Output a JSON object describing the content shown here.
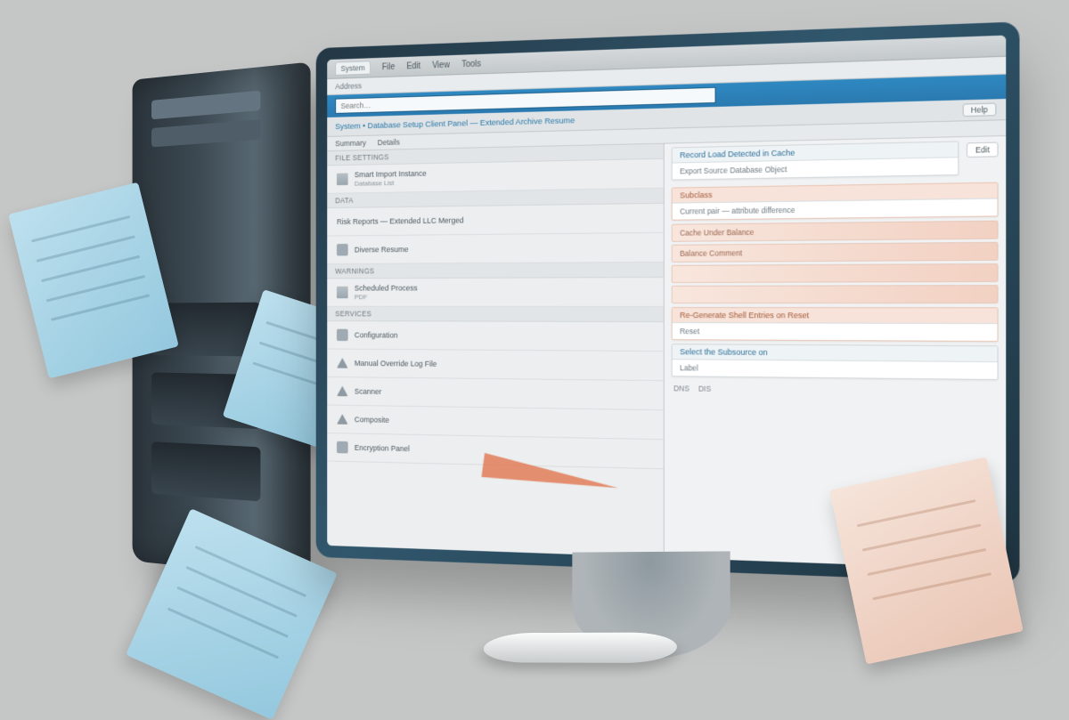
{
  "titlebar": {
    "tab": "System",
    "menus": [
      "File",
      "Edit",
      "View",
      "Tools"
    ]
  },
  "toolbar": {
    "address_label": "Address"
  },
  "search": {
    "placeholder": "Search…"
  },
  "header": {
    "title": "System • Database Setup Client Panel — Extended Archive Resume",
    "button": "Help"
  },
  "subtabs": {
    "t1": "Summary",
    "t2": "Details"
  },
  "left": {
    "sec1": {
      "title": "File Settings"
    },
    "row1": {
      "a": "Smart Import Instance",
      "b": "Database List"
    },
    "sec2": {
      "title": "Data"
    },
    "row2": {
      "a": "Risk Reports — Extended LLC Merged"
    },
    "row3": {
      "a": "Diverse Resume"
    },
    "sec3": {
      "title": "Warnings"
    },
    "row4": {
      "a": "Scheduled Process",
      "b": "PDF"
    },
    "sec4": {
      "title": "Services"
    },
    "row5": {
      "a": "Configuration"
    },
    "row6": {
      "a": "Manual Override Log File"
    },
    "row7": {
      "a": "Scanner"
    },
    "row8": {
      "a": "Composite"
    },
    "row9": {
      "a": "Encryption Panel"
    }
  },
  "right": {
    "card1": {
      "hd": "Record Load Detected in Cache",
      "bd": "Export Source Database Object"
    },
    "btn1": "Edit",
    "card2": {
      "hd": "Subclass",
      "bd": "Current pair — attribute difference"
    },
    "stripe1": "Cache Under Balance",
    "stripe2": "Balance Comment",
    "card3": {
      "hd": "Re-Generate Shell Entries on Reset",
      "bd": "Reset"
    },
    "card4": {
      "hd": "Select the Subsource on",
      "bd": "Label"
    },
    "foot": {
      "a": "DNS",
      "b": "DIS"
    }
  }
}
